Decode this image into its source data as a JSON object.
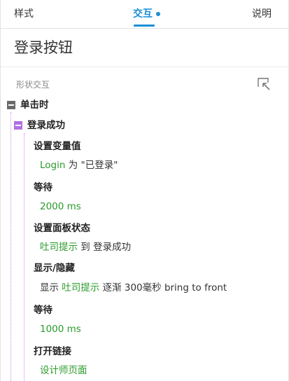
{
  "tabs": {
    "style": "样式",
    "interaction": "交互",
    "notes": "说明"
  },
  "page_title": "登录按钮",
  "section": {
    "label": "形状交互",
    "icon": "expand-corner-icon"
  },
  "tree": {
    "event": "单击时",
    "case": "登录成功",
    "actions": [
      {
        "title": "设置变量值",
        "target": "Login",
        "middle": " 为 \"已登录\"",
        "tail": ""
      },
      {
        "title": "等待",
        "value": "2000 ms"
      },
      {
        "title": "设置面板状态",
        "target": "吐司提示",
        "middle": " 到 登录成功"
      },
      {
        "title": "显示/隐藏",
        "prefix": "显示 ",
        "target": "吐司提示",
        "middle": " 逐渐 300毫秒 bring to front"
      },
      {
        "title": "等待",
        "value": "1000 ms"
      },
      {
        "title": "打开链接",
        "value": "设计师页面"
      }
    ]
  },
  "colors": {
    "accent": "#1a8ed6",
    "green": "#2a9a2a",
    "purple": "#b36fe0"
  }
}
